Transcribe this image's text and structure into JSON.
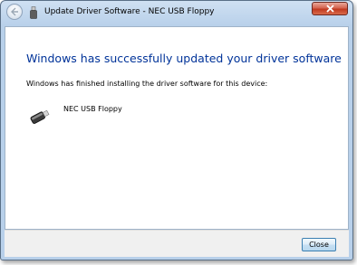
{
  "window": {
    "title": "Update Driver Software - NEC USB Floppy"
  },
  "main": {
    "headline": "Windows has successfully updated your driver software",
    "subtext": "Windows has finished installing the driver software for this device:",
    "device_name": "NEC USB Floppy",
    "device_icon": "usb-drive-icon"
  },
  "footer": {
    "close_label": "Close"
  },
  "icons": {
    "back": "back-arrow-icon",
    "title": "usb-device-icon",
    "close": "close-icon"
  },
  "colors": {
    "headline": "#003399",
    "title_close_button": "#c0391f",
    "frame": "#b8d0ea"
  }
}
